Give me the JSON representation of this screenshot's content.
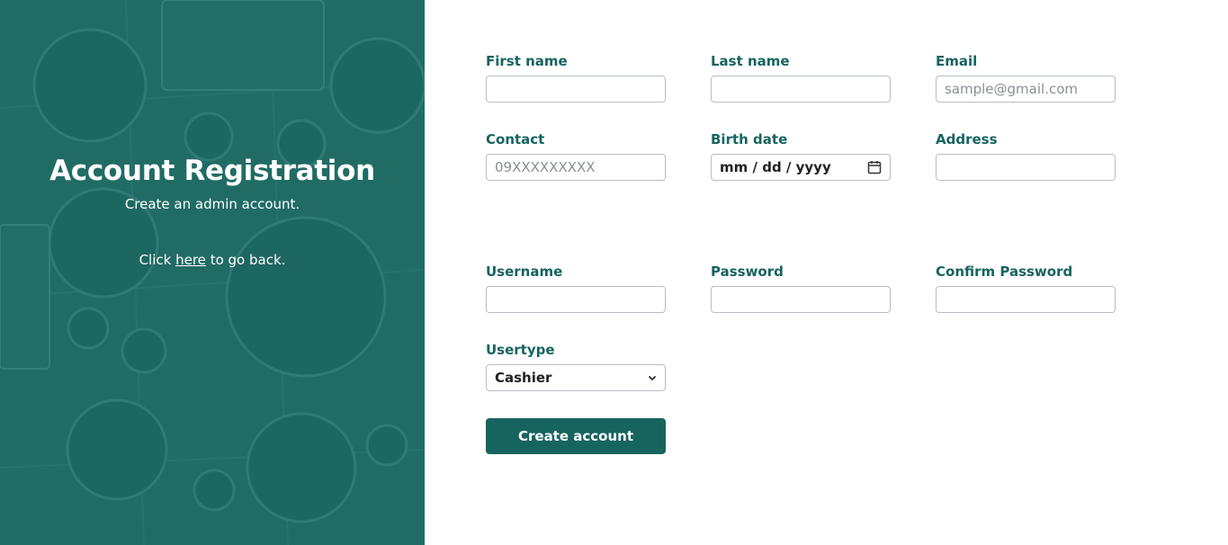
{
  "hero": {
    "title": "Account Registration",
    "subtitle": "Create an admin account.",
    "back_prefix": "Click",
    "back_link": "here",
    "back_suffix": "to go back."
  },
  "form": {
    "first_name": {
      "label": "First name",
      "value": "",
      "placeholder": ""
    },
    "last_name": {
      "label": "Last name",
      "value": "",
      "placeholder": ""
    },
    "email": {
      "label": "Email",
      "value": "",
      "placeholder": "sample@gmail.com"
    },
    "contact": {
      "label": "Contact",
      "value": "",
      "placeholder": "09XXXXXXXXX"
    },
    "birth_date": {
      "label": "Birth date",
      "mm": "mm",
      "dd": "dd",
      "yyyy": "yyyy"
    },
    "address": {
      "label": "Address",
      "value": "",
      "placeholder": ""
    },
    "username": {
      "label": "Username",
      "value": "",
      "placeholder": ""
    },
    "password": {
      "label": "Password",
      "value": "",
      "placeholder": ""
    },
    "confirm_password": {
      "label": "Confirm Password",
      "value": "",
      "placeholder": ""
    },
    "usertype": {
      "label": "Usertype",
      "selected": "Cashier"
    },
    "submit_label": "Create account"
  },
  "colors": {
    "accent": "#17645f",
    "hero_overlay": "#1f6b65"
  },
  "icons": {
    "calendar": "calendar-icon",
    "select_arrow": "chevron-down-icon"
  }
}
